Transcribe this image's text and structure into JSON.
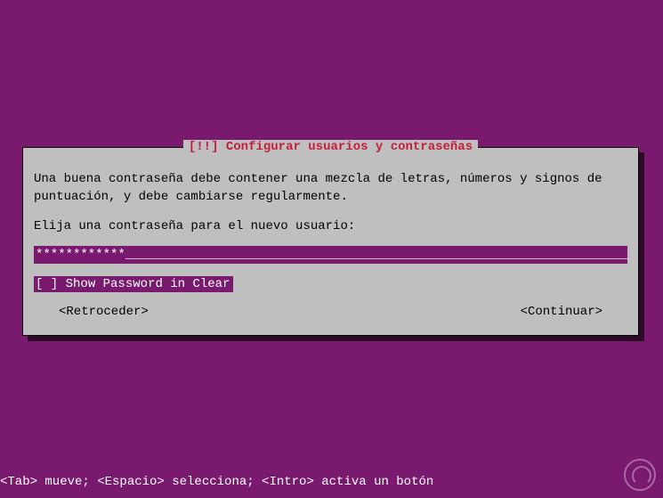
{
  "dialog": {
    "title": "[!!] Configurar usuarios y contraseñas",
    "body": "Una buena contraseña debe contener una mezcla de letras, números y signos de puntuación, y debe cambiarse regularmente.",
    "prompt": "Elija una contraseña para el nuevo usuario:",
    "password_value": "************",
    "checkbox": {
      "checked_display": "[ ]",
      "label": "Show Password in Clear"
    },
    "buttons": {
      "back": "<Retroceder>",
      "continue": "<Continuar>"
    }
  },
  "footer": {
    "hint": "<Tab> mueve; <Espacio> selecciona; <Intro> activa un botón"
  }
}
